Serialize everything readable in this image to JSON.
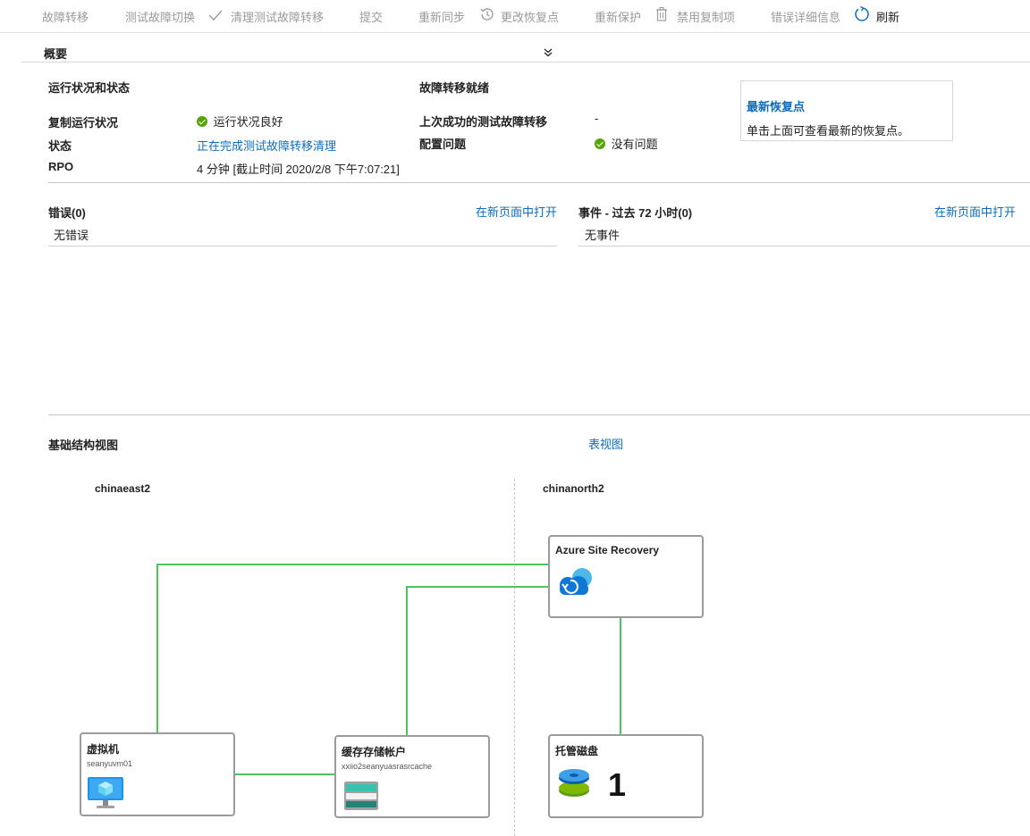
{
  "toolbar": {
    "failover": "故障转移",
    "test_failover": "测试故障切换",
    "cleanup_test_failover": "清理测试故障转移",
    "commit": "提交",
    "resync": "重新同步",
    "change_recovery_point": "更改恢复点",
    "reprotect": "重新保护",
    "disable_replication": "禁用复制项",
    "error_details": "错误详细信息",
    "refresh": "刷新"
  },
  "overview": {
    "title": "概要"
  },
  "health": {
    "heading": "运行状况和状态",
    "replication_health_label": "复制运行状况",
    "replication_health_value": "运行状况良好",
    "status_label": "状态",
    "status_value": "正在完成测试故障转移清理",
    "rpo_label": "RPO",
    "rpo_value": "4 分钟 [截止时间 2020/2/8 下午7:07:21]"
  },
  "failover_readiness": {
    "heading": "故障转移就绪",
    "last_test_label": "上次成功的测试故障转移",
    "last_test_value": "-",
    "config_issues_label": "配置问题",
    "config_issues_value": "没有问题"
  },
  "recovery_point_card": {
    "title": "最新恢复点",
    "text": "单击上面可查看最新的恢复点。"
  },
  "errors": {
    "heading": "错误(0)",
    "open_link": "在新页面中打开",
    "empty": "无错误"
  },
  "events": {
    "heading": "事件 - 过去 72 小时(0)",
    "open_link": "在新页面中打开",
    "empty": "无事件"
  },
  "infrastructure": {
    "heading": "基础结构视图",
    "table_view_link": "表视图",
    "source_region": "chinaeast2",
    "target_region": "chinanorth2",
    "vm": {
      "title": "虚拟机",
      "name": "seanyuvm01"
    },
    "cache_storage": {
      "title": "缓存存储帐户",
      "name": "xxiio2seanyuasrasrcache"
    },
    "asr": {
      "title": "Azure Site Recovery"
    },
    "managed_disks": {
      "title": "托管磁盘",
      "count": "1"
    }
  },
  "colors": {
    "accent": "#0f6cbd",
    "healthy": "#57a300",
    "connector": "#4fc35c"
  }
}
